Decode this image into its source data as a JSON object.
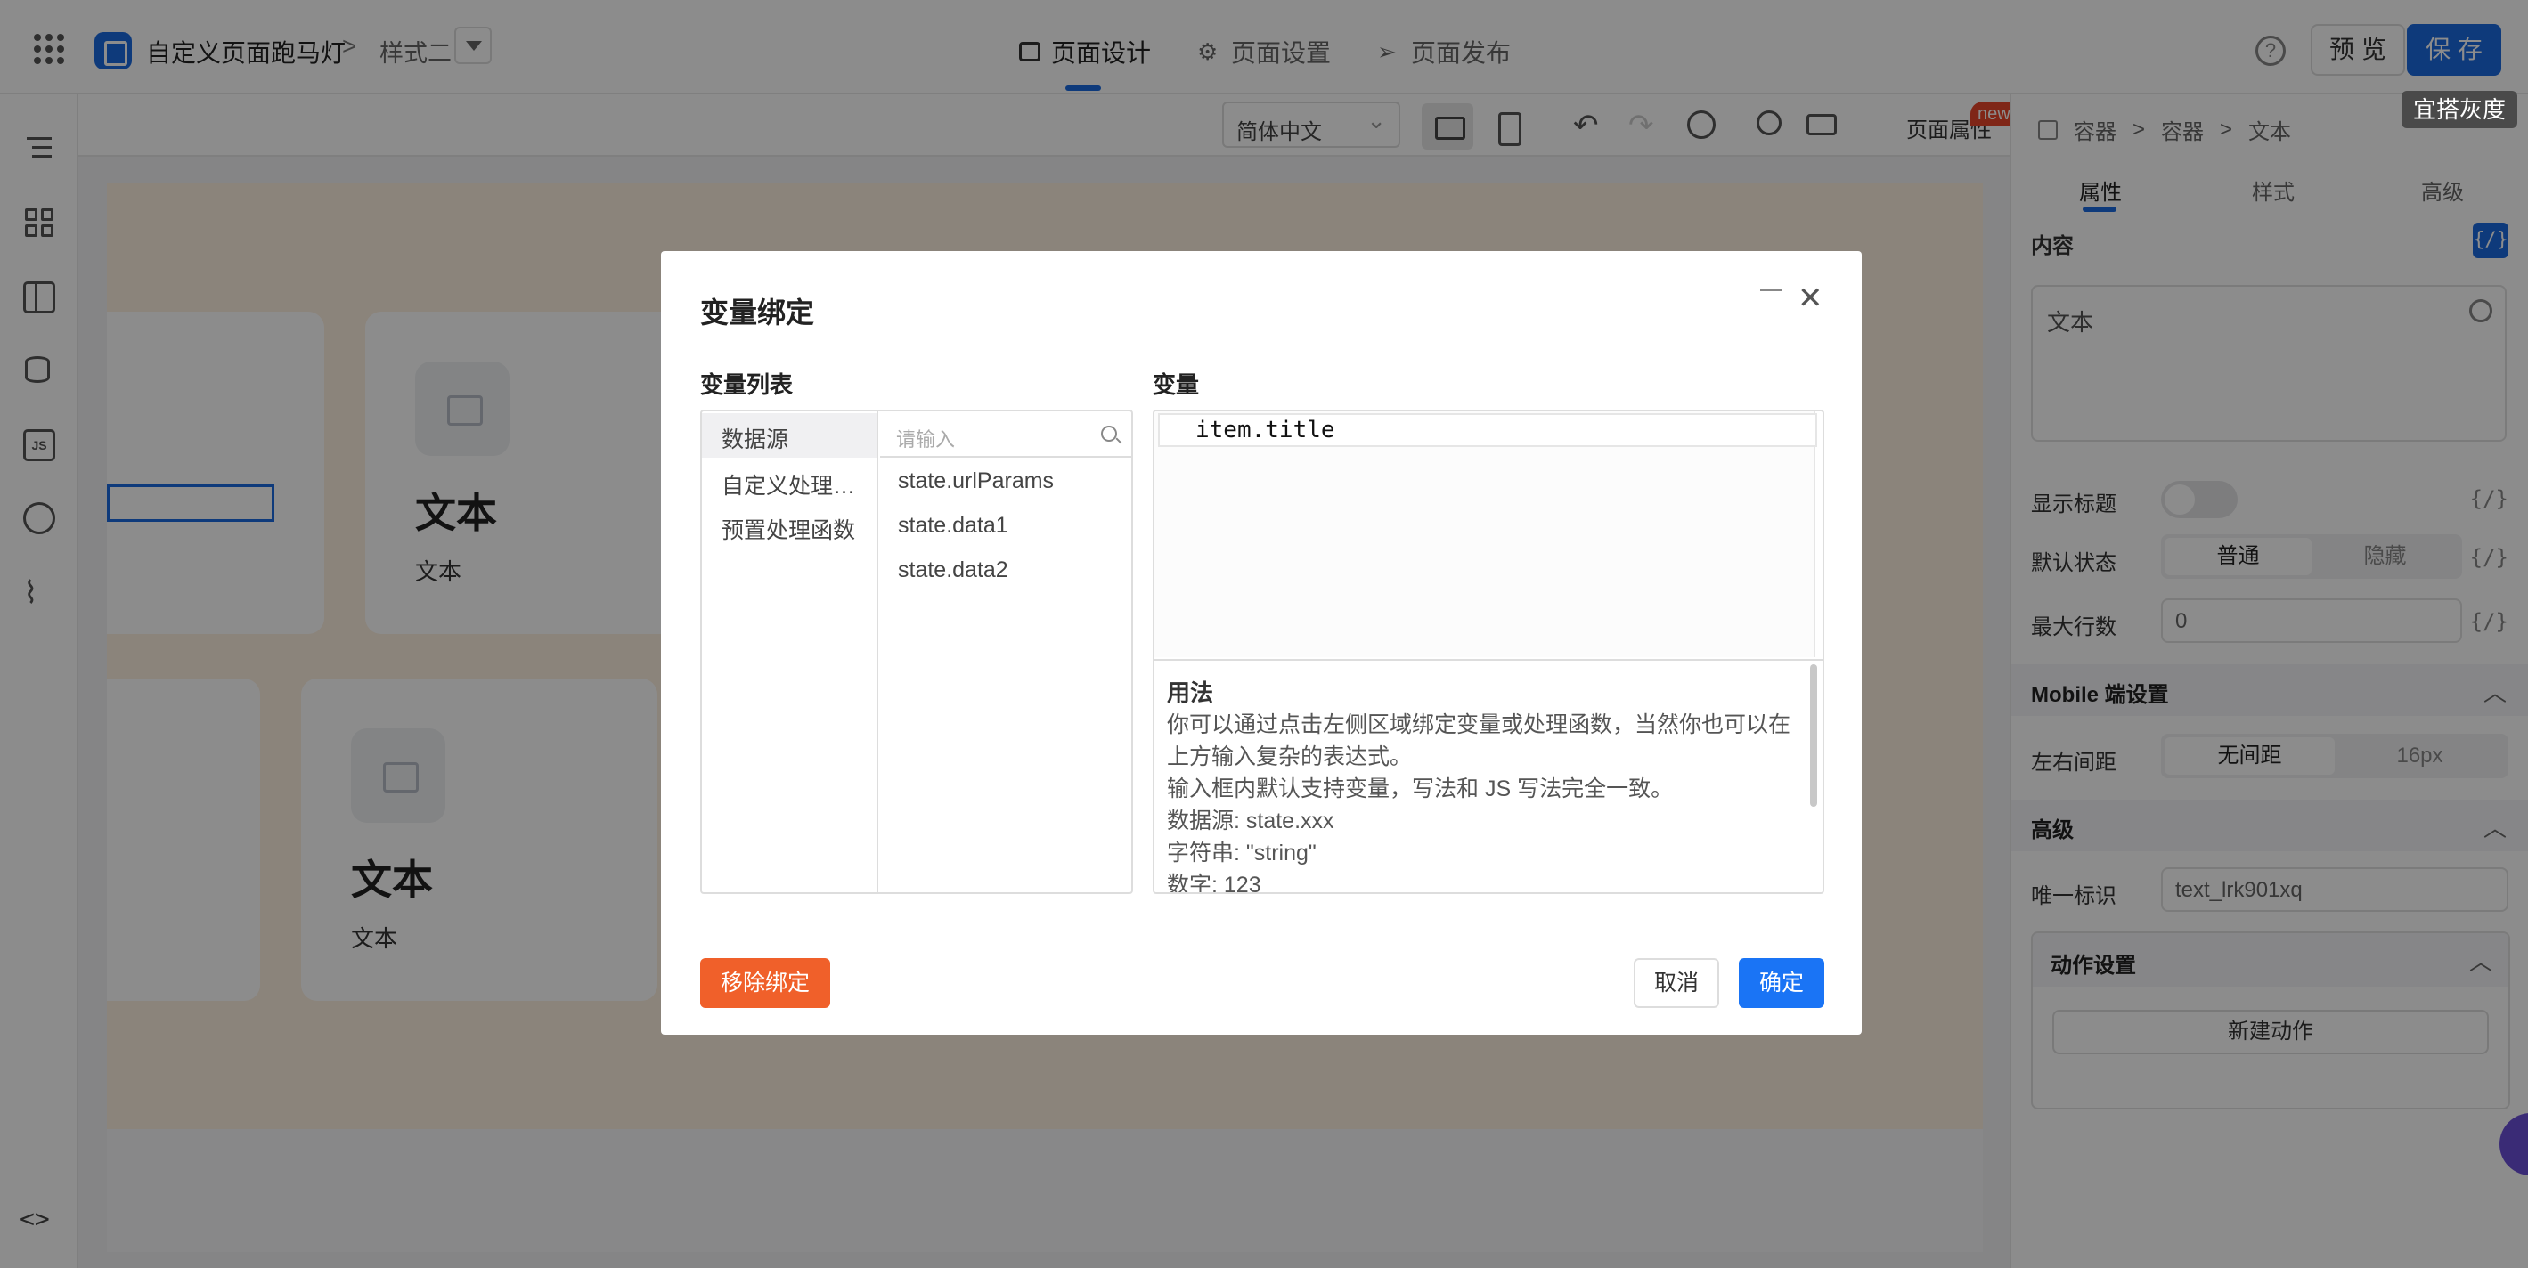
{
  "topbar": {
    "app_title": "自定义页面跑马灯",
    "crumb_separator": ">",
    "style_name": "样式二",
    "tabs": [
      {
        "label": "页面设计",
        "icon": "layout-icon"
      },
      {
        "label": "页面设置",
        "icon": "gear-icon"
      },
      {
        "label": "页面发布",
        "icon": "send-icon"
      }
    ],
    "help_label": "?",
    "preview_label": "预 览",
    "save_label": "保 存",
    "gray_tag": "宜搭灰度"
  },
  "toolbar": {
    "language": "简体中文",
    "page_attr_label": "页面属性",
    "new_badge": "new"
  },
  "canvas": {
    "cards": [
      {
        "title": "文本",
        "subtitle": "文本"
      },
      {
        "title": "文本",
        "subtitle": "文本"
      }
    ]
  },
  "right_panel": {
    "breadcrumb": [
      "容器",
      "容器",
      "文本"
    ],
    "crumb_separator": ">",
    "tabs": [
      "属性",
      "样式",
      "高级"
    ],
    "content_label": "内容",
    "fx_label": "{/}",
    "content_value": "文本",
    "show_title_label": "显示标题",
    "default_state_label": "默认状态",
    "default_state_options": [
      "普通",
      "隐藏"
    ],
    "max_lines_label": "最大行数",
    "max_lines_value": "0",
    "mobile_section": "Mobile 端设置",
    "lr_margin_label": "左右间距",
    "lr_margin_options": [
      "无间距",
      "16px"
    ],
    "advanced_section": "高级",
    "unique_id_label": "唯一标识",
    "unique_id_value": "text_lrk901xq",
    "action_section": "动作设置",
    "new_action_label": "新建动作"
  },
  "dialog": {
    "title": "变量绑定",
    "var_list_label": "变量列表",
    "var_label": "变量",
    "categories": [
      "数据源",
      "自定义处理函数",
      "预置处理函数"
    ],
    "search_placeholder": "请输入",
    "variables": [
      "state.urlParams",
      "state.data1",
      "state.data2"
    ],
    "code": "item.title",
    "usage_title": "用法",
    "usage_lines": [
      "你可以通过点击左侧区域绑定变量或处理函数，当然你也可以在",
      "上方输入复杂的表达式。",
      "输入框内默认支持变量，写法和 JS 写法完全一致。",
      "数据源: state.xxx",
      "字符串: \"string\"",
      "数字: 123"
    ],
    "unbind_label": "移除绑定",
    "cancel_label": "取消",
    "ok_label": "确定",
    "close_icon": "close-icon",
    "minimize_icon": "minimize-icon"
  },
  "colors": {
    "primary": "#1a6ae0",
    "danger": "#f0602a",
    "canvas_bg": "#fdf0e0"
  }
}
